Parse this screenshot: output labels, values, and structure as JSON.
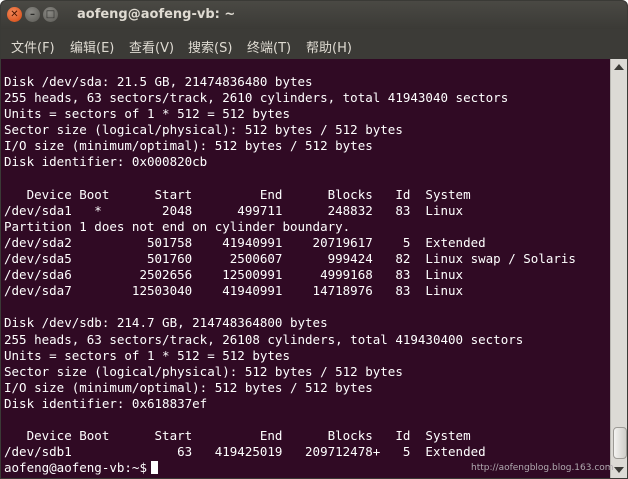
{
  "window": {
    "title": "aofeng@aofeng-vb: ~",
    "close_glyph": "✕",
    "min_glyph": "–",
    "max_glyph": "□"
  },
  "menu": {
    "file": "文件(F)",
    "edit": "编辑(E)",
    "view": "查看(V)",
    "search": "搜索(S)",
    "terminal": "终端(T)",
    "help": "帮助(H)"
  },
  "terminal": {
    "lines": [
      "Disk /dev/sda: 21.5 GB, 21474836480 bytes",
      "255 heads, 63 sectors/track, 2610 cylinders, total 41943040 sectors",
      "Units = sectors of 1 * 512 = 512 bytes",
      "Sector size (logical/physical): 512 bytes / 512 bytes",
      "I/O size (minimum/optimal): 512 bytes / 512 bytes",
      "Disk identifier: 0x000820cb",
      "",
      "   Device Boot      Start         End      Blocks   Id  System",
      "/dev/sda1   *        2048      499711      248832   83  Linux",
      "Partition 1 does not end on cylinder boundary.",
      "/dev/sda2          501758    41940991    20719617    5  Extended",
      "/dev/sda5          501760     2500607      999424   82  Linux swap / Solaris",
      "/dev/sda6         2502656    12500991     4999168   83  Linux",
      "/dev/sda7        12503040    41940991    14718976   83  Linux",
      "",
      "Disk /dev/sdb: 214.7 GB, 214748364800 bytes",
      "255 heads, 63 sectors/track, 26108 cylinders, total 419430400 sectors",
      "Units = sectors of 1 * 512 = 512 bytes",
      "Sector size (logical/physical): 512 bytes / 512 bytes",
      "I/O size (minimum/optimal): 512 bytes / 512 bytes",
      "Disk identifier: 0x618837ef",
      "",
      "   Device Boot      Start         End      Blocks   Id  System",
      "/dev/sdb1              63   419425019   209712478+   5  Extended"
    ],
    "prompt": "aofeng@aofeng-vb:~$"
  },
  "watermark": "http://aofengblog.blog.163.com",
  "colors": {
    "terminal_bg": "#300a24",
    "terminal_fg": "#ffffff",
    "titlebar_bg": "#3c3b37",
    "close_button": "#e05a20"
  }
}
